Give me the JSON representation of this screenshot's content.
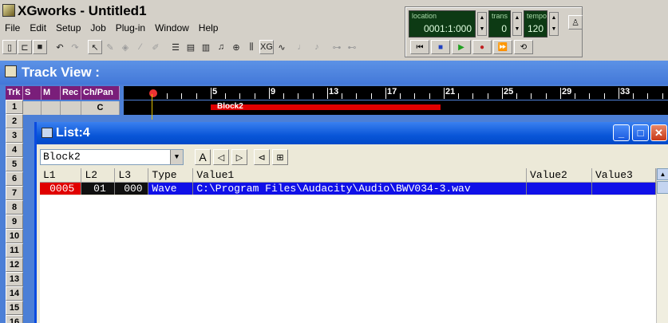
{
  "app": {
    "title": "XGworks - Untitled1"
  },
  "menu": [
    "File",
    "Edit",
    "Setup",
    "Job",
    "Plug-in",
    "Window",
    "Help"
  ],
  "toolbar": {
    "icons": [
      "new-file-icon",
      "open-folder-icon",
      "save-icon",
      "undo-icon",
      "redo-icon",
      "pointer-icon",
      "pencil-icon",
      "eraser-icon",
      "draw-icon",
      "brush-icon",
      "track-view-icon",
      "piano-roll-icon",
      "staff-view-icon",
      "score-icon",
      "drum-icon",
      "mixer-icon",
      "xg-icon",
      "wave-icon",
      "metronome-icon",
      "tempo-icon",
      "punch-in-icon",
      "punch-out-icon"
    ]
  },
  "transport": {
    "location": {
      "label": "location",
      "value": "0001:1:000"
    },
    "trans": {
      "label": "trans",
      "value": "0"
    },
    "tempo": {
      "label": "tempo",
      "value": "120"
    },
    "buttons": [
      "rewind-icon",
      "stop-icon",
      "play-icon",
      "record-icon",
      "fast-forward-icon",
      "end-icon",
      "loop-icon"
    ]
  },
  "track_view": {
    "title": "Track View :",
    "headers": [
      "Trk",
      "S",
      "M",
      "Rec",
      "Ch/Pan"
    ],
    "tracks": [
      "1",
      "2",
      "3",
      "4",
      "5",
      "6",
      "7",
      "8",
      "9",
      "10",
      "11",
      "12",
      "13",
      "14",
      "15",
      "16"
    ],
    "row1_chpan": "C",
    "measures": [
      "5",
      "9",
      "13",
      "17",
      "21",
      "25",
      "29",
      "33"
    ],
    "block_label": "Block2",
    "colors": {
      "block": "#e00000",
      "title": "#4378d8"
    }
  },
  "list_window": {
    "title": "List:4",
    "combo_value": "Block2",
    "columns": [
      "L1",
      "L2",
      "L3",
      "Type",
      "Value1",
      "Value2",
      "Value3"
    ],
    "rows": [
      {
        "l1": "0005",
        "l2": "01",
        "l3": "000",
        "type": "Wave",
        "value1": "C:\\Program Files\\Audacity\\Audio\\BWV034-3.wav",
        "value2": "",
        "value3": ""
      }
    ],
    "window_buttons": [
      "minimize-icon",
      "maximize-icon",
      "close-icon"
    ],
    "tool_buttons": [
      "A",
      "speaker-left-icon",
      "speaker-right-icon",
      "filter-icon",
      "insert-icon"
    ]
  }
}
